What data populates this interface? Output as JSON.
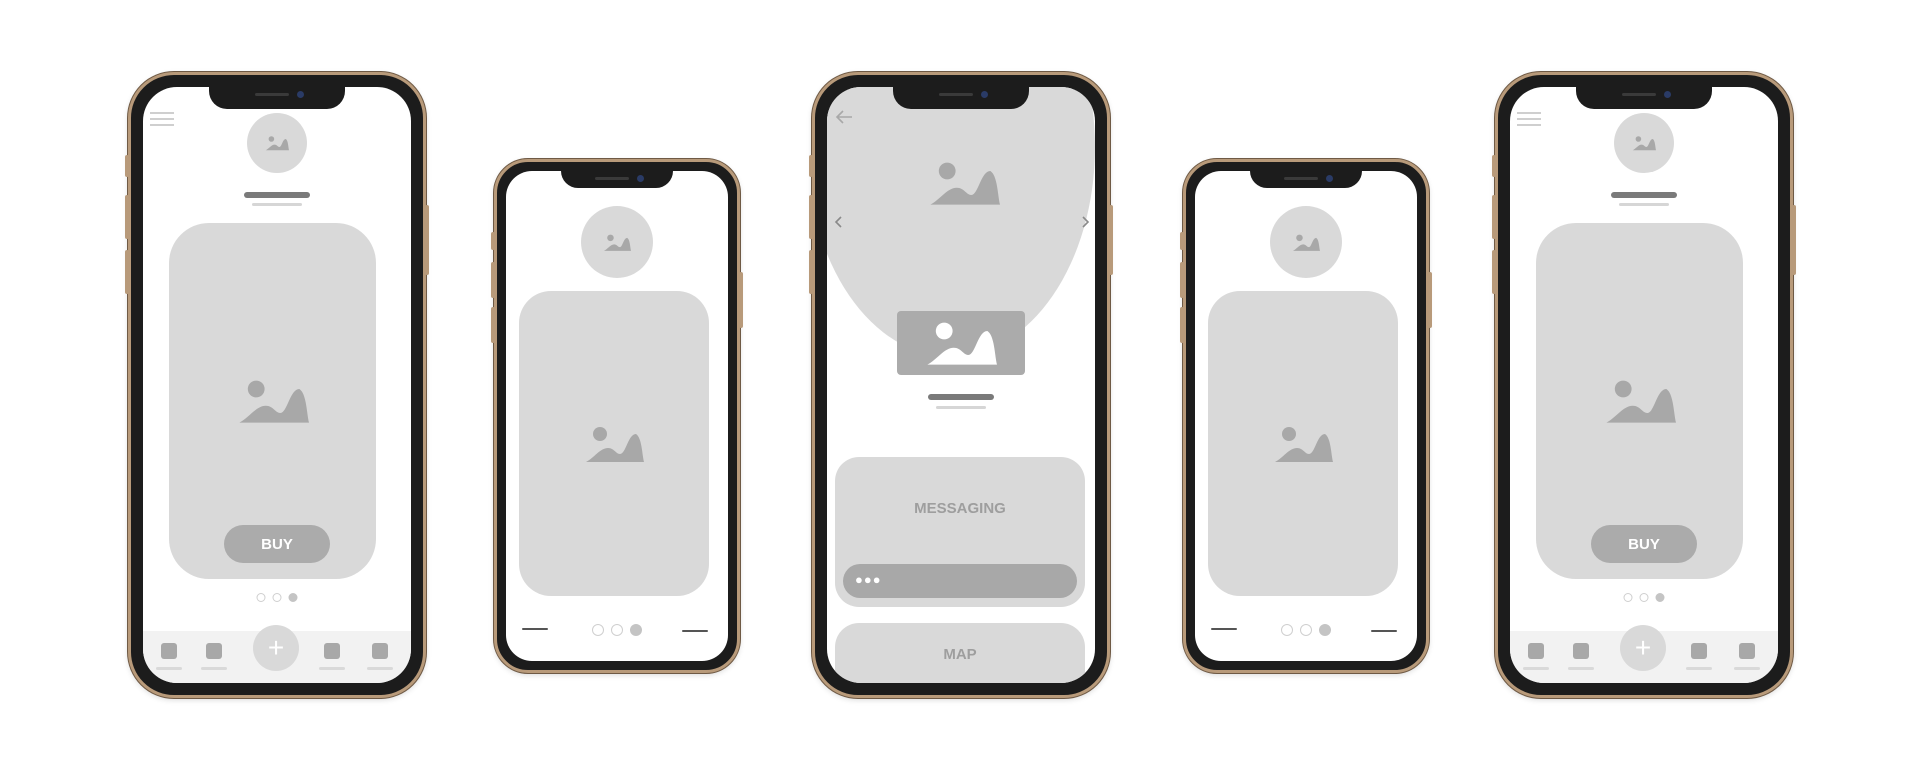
{
  "phones": {
    "p1": {
      "buy_label": "BUY",
      "icons": [
        "menu-icon",
        "image-icon"
      ]
    },
    "p3": {
      "messaging_label": "MESSAGING",
      "message_dots": "●●●",
      "map_label": "MAP",
      "icons": [
        "back-arrow-icon",
        "chevron-left-icon",
        "chevron-right-icon",
        "image-icon"
      ]
    },
    "p5": {
      "buy_label": "BUY"
    }
  },
  "tabbar": {
    "fab_label": "+"
  },
  "colors": {
    "placeholder": "#d9d9d9",
    "icon": "#a8a8a8",
    "frame": "#b89a7a"
  }
}
